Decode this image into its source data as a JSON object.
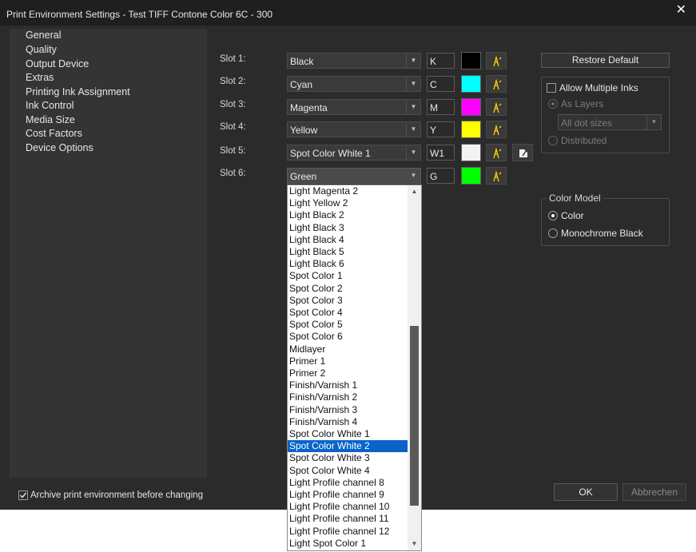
{
  "window": {
    "title": "Print Environment Settings - Test TIFF Contone Color 6C - 300",
    "close_glyph": "✕"
  },
  "sidebar": {
    "items": [
      {
        "label": "General"
      },
      {
        "label": "Quality"
      },
      {
        "label": "Output Device"
      },
      {
        "label": "Extras"
      },
      {
        "label": "Printing Ink Assignment"
      },
      {
        "label": "Ink Control"
      },
      {
        "label": "Media Size"
      },
      {
        "label": "Cost Factors"
      },
      {
        "label": "Device Options"
      }
    ]
  },
  "slots": [
    {
      "label": "Slot 1:",
      "ink": "Black",
      "abbr": "K",
      "color": "#000000"
    },
    {
      "label": "Slot 2:",
      "ink": "Cyan",
      "abbr": "C",
      "color": "#00ffff"
    },
    {
      "label": "Slot 3:",
      "ink": "Magenta",
      "abbr": "M",
      "color": "#ff00ff"
    },
    {
      "label": "Slot 4:",
      "ink": "Yellow",
      "abbr": "Y",
      "color": "#ffff00"
    },
    {
      "label": "Slot 5:",
      "ink": "Spot Color White 1",
      "abbr": "W1",
      "color": "#f2f2f2"
    },
    {
      "label": "Slot 6:",
      "ink": "Green",
      "abbr": "G",
      "color": "#00ff00"
    }
  ],
  "icons": {
    "ink_tool": "ink-pen-icon",
    "edit": "edit-icon",
    "combo_arrow": "chevron-down-icon",
    "scroll_up": "scroll-up-icon",
    "scroll_down": "scroll-down-icon",
    "arrow_down_glyph": "▼",
    "arrow_up_glyph": "▲"
  },
  "colors": {
    "accent": "#ffd700",
    "selection": "#0a64c8"
  },
  "dropdown": {
    "items": [
      "Light Magenta 2",
      "Light Yellow 2",
      "Light Black 2",
      "Light Black 3",
      "Light Black 4",
      "Light Black 5",
      "Light Black 6",
      "Spot Color 1",
      "Spot Color 2",
      "Spot Color 3",
      "Spot Color 4",
      "Spot Color 5",
      "Spot Color 6",
      "Midlayer",
      "Primer 1",
      "Primer 2",
      "Finish/Varnish 1",
      "Finish/Varnish 2",
      "Finish/Varnish 3",
      "Finish/Varnish 4",
      "Spot Color White 1",
      "Spot Color White 2",
      "Spot Color White 3",
      "Spot Color White 4",
      "Light Profile channel 8",
      "Light Profile channel 9",
      "Light Profile channel 10",
      "Light Profile channel 11",
      "Light Profile channel 12",
      "Light Spot Color 1"
    ],
    "selected": "Spot Color White 2"
  },
  "right_panel": {
    "restore_default": "Restore Default",
    "allow_multiple_inks": "Allow Multiple Inks",
    "allow_multiple_checked": false,
    "as_layers": "As Layers",
    "dot_sizes": "All dot sizes",
    "distributed": "Distributed",
    "color_model": {
      "title": "Color Model",
      "options": [
        "Color",
        "Monochrome Black"
      ],
      "selected": "Color"
    }
  },
  "footer": {
    "archive_label": "Archive print environment before changing",
    "archive_checked": true,
    "ok": "OK",
    "cancel": "Abbrechen"
  }
}
